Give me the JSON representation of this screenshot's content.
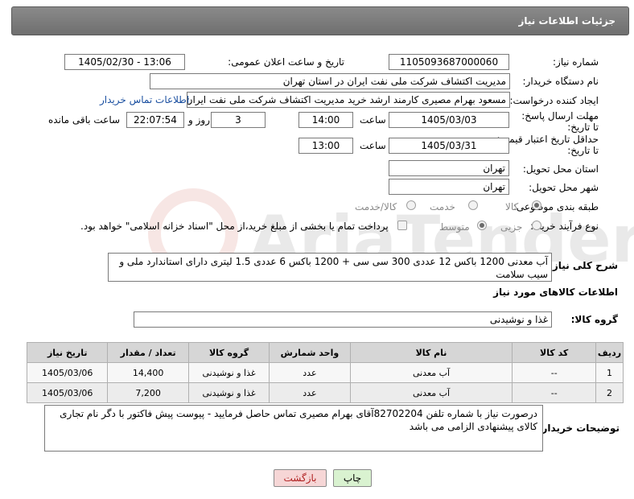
{
  "header": {
    "title": "جزئیات اطلاعات نیاز"
  },
  "form": {
    "need_number_label": "شماره نیاز:",
    "need_number": "1105093687000060",
    "announce_label": "تاریخ و ساعت اعلان عمومی:",
    "announce_value": "1405/02/30 - 13:06",
    "buyer_org_label": "نام دستگاه خریدار:",
    "buyer_org": "مدیریت اکتشاف شرکت ملی نفت ایران در استان تهران",
    "requester_label": "ایجاد کننده درخواست:",
    "requester": "مسعود بهرام مصیری کارمند ارشد خرید مدیریت اکتشاف شرکت ملی نفت ایران",
    "contact_link": "اطلاعات تماس خریدار",
    "deadline_label": "مهلت ارسال پاسخ: تا تاریخ:",
    "deadline_date": "1405/03/03",
    "time_label": "ساعت",
    "deadline_time": "14:00",
    "days_value": "3",
    "days_label": "روز و",
    "remaining_time": "22:07:54",
    "remaining_label": "ساعت باقی مانده",
    "validity_label": "حداقل تاریخ اعتبار قیمت: تا تاریخ:",
    "validity_date": "1405/03/31",
    "validity_time_label": "ساعت",
    "validity_time": "13:00",
    "province_label": "استان محل تحویل:",
    "province": "تهران",
    "city_label": "شهر محل تحویل:",
    "city": "تهران",
    "category_label": "طبقه بندی موضوعی:",
    "category_options": [
      "کالا",
      "خدمت",
      "کالا/خدمت"
    ],
    "category_selected": "کالا",
    "process_label": "نوع فرآیند خرید :",
    "process_options": [
      "جزیی",
      "متوسط"
    ],
    "process_selected": "متوسط",
    "payment_note": "پرداخت تمام یا بخشی از مبلغ خرید،از محل \"اسناد خزانه اسلامی\" خواهد بود."
  },
  "description": {
    "label": "شرح کلی نیاز:",
    "text": "آب معدنی 1200 باکس 12 عددی 300 سی سی + 1200 باکس 6 عددی 1.5 لیتری دارای استاندارد ملی و سیب سلامت"
  },
  "goods": {
    "section_title": "اطلاعات کالاهای مورد نیاز",
    "group_label": "گروه کالا:",
    "group_value": "غذا و نوشیدنی",
    "columns": [
      "ردیف",
      "کد کالا",
      "نام کالا",
      "واحد شمارش",
      "گروه کالا",
      "تعداد / مقدار",
      "تاریخ نیاز"
    ],
    "rows": [
      [
        "1",
        "--",
        "آب معدنی",
        "عدد",
        "غذا و نوشیدنی",
        "14,400",
        "1405/03/06"
      ],
      [
        "2",
        "--",
        "آب معدنی",
        "عدد",
        "غذا و نوشیدنی",
        "7,200",
        "1405/03/06"
      ]
    ]
  },
  "notes": {
    "label": "توضیحات خریدار:",
    "text": "درصورت نیاز با شماره تلفن 82702204آقای بهرام مصیری تماس حاصل فرمایید - پیوست پیش فاکتور با دگر نام تجاری کالای پیشنهادی الزامی می باشد"
  },
  "buttons": {
    "print": "چاپ",
    "back": "بازگشت"
  },
  "colors": {
    "header_bg": "#7d7d7d",
    "link": "#1a4fa0",
    "back_btn_bg": "#f6d6d6",
    "print_btn_bg": "#d9f2d0"
  }
}
